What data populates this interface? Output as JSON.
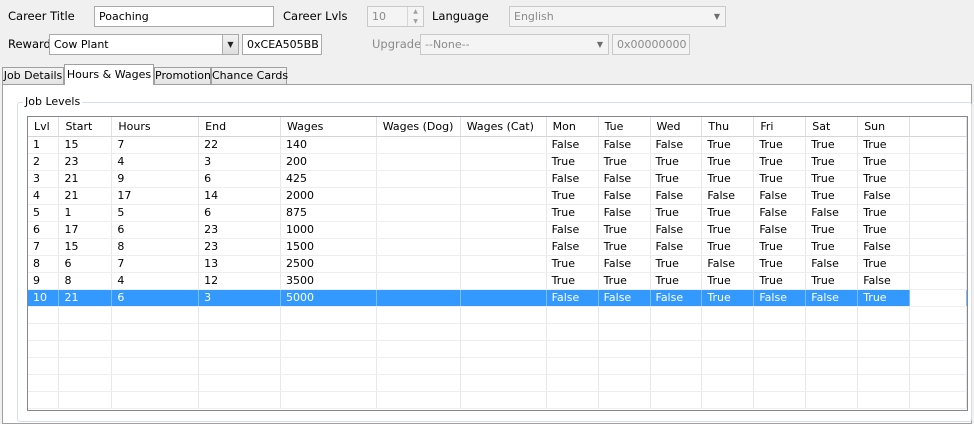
{
  "header": {
    "career_title_label": "Career Title",
    "career_title_value": "Poaching",
    "career_lvls_label": "Career Lvls",
    "career_lvls_value": "10",
    "language_label": "Language",
    "language_value": "English",
    "reward_label": "Reward",
    "reward_value": "Cow Plant",
    "reward_hex": "0xCEA505BB",
    "upgrade_label": "Upgrade",
    "upgrade_value": "--None--",
    "upgrade_hex": "0x00000000"
  },
  "tabs": [
    {
      "label": "Job Details"
    },
    {
      "label": "Hours & Wages"
    },
    {
      "label": "Promotion"
    },
    {
      "label": "Chance Cards"
    }
  ],
  "active_tab": "Hours & Wages",
  "group_title": "Job Levels",
  "table": {
    "columns": [
      "Lvl",
      "Start",
      "Hours",
      "End",
      "Wages",
      "Wages (Dog)",
      "Wages (Cat)",
      "Mon",
      "Tue",
      "Wed",
      "Thu",
      "Fri",
      "Sat",
      "Sun"
    ],
    "rows": [
      [
        "1",
        "15",
        "7",
        "22",
        "140",
        "",
        "",
        "False",
        "False",
        "False",
        "True",
        "True",
        "True",
        "True"
      ],
      [
        "2",
        "23",
        "4",
        "3",
        "200",
        "",
        "",
        "True",
        "True",
        "True",
        "True",
        "True",
        "True",
        "True"
      ],
      [
        "3",
        "21",
        "9",
        "6",
        "425",
        "",
        "",
        "False",
        "False",
        "True",
        "True",
        "True",
        "True",
        "True"
      ],
      [
        "4",
        "21",
        "17",
        "14",
        "2000",
        "",
        "",
        "True",
        "False",
        "False",
        "False",
        "False",
        "True",
        "False"
      ],
      [
        "5",
        "1",
        "5",
        "6",
        "875",
        "",
        "",
        "True",
        "False",
        "True",
        "True",
        "False",
        "False",
        "True"
      ],
      [
        "6",
        "17",
        "6",
        "23",
        "1000",
        "",
        "",
        "False",
        "True",
        "False",
        "True",
        "False",
        "True",
        "True"
      ],
      [
        "7",
        "15",
        "8",
        "23",
        "1500",
        "",
        "",
        "False",
        "True",
        "False",
        "True",
        "True",
        "True",
        "False"
      ],
      [
        "8",
        "6",
        "7",
        "13",
        "2500",
        "",
        "",
        "True",
        "False",
        "True",
        "False",
        "True",
        "False",
        "True"
      ],
      [
        "9",
        "8",
        "4",
        "12",
        "3500",
        "",
        "",
        "True",
        "True",
        "True",
        "True",
        "True",
        "True",
        "False"
      ],
      [
        "10",
        "21",
        "6",
        "3",
        "5000",
        "",
        "",
        "False",
        "False",
        "False",
        "True",
        "False",
        "False",
        "True"
      ]
    ],
    "selected_row": 9
  },
  "colors": {
    "selection": "#3399ff",
    "window_bg": "#f0f0f0"
  }
}
